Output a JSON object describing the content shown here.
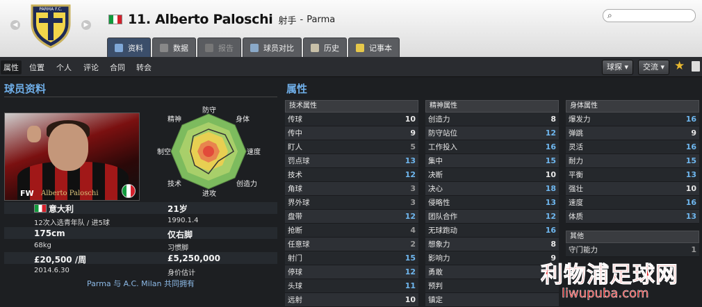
{
  "header": {
    "player_number_name": "11. Alberto Paloschi",
    "role": "射手",
    "club": "Parma",
    "crest_text": "PARMA F.C.",
    "search_icon": "search-icon"
  },
  "tabs": [
    {
      "label": "资料",
      "icon": "profile-icon"
    },
    {
      "label": "数据",
      "icon": "stats-icon"
    },
    {
      "label": "报告",
      "icon": "report-icon"
    },
    {
      "label": "球员对比",
      "icon": "compare-icon"
    },
    {
      "label": "历史",
      "icon": "history-icon"
    },
    {
      "label": "记事本",
      "icon": "notebook-icon"
    }
  ],
  "subnav": {
    "items": [
      "属性",
      "位置",
      "个人",
      "评论",
      "合同",
      "转会"
    ],
    "scout_button": "球探",
    "interact_button": "交流"
  },
  "profile": {
    "title": "球员资料",
    "position": "FW",
    "photo_caption": "Alberto Paloschi",
    "radar_labels": [
      "防守",
      "身体",
      "速度",
      "创造力",
      "进攻",
      "技术",
      "制空",
      "精神"
    ],
    "nationality": "意大利",
    "caps": "12次入选青年队 / 进5球",
    "age": "21岁",
    "dob": "1990.1.4",
    "height": "175cm",
    "weight": "68kg",
    "foot": "仅右脚",
    "foot_label": "习惯脚",
    "wage": "£20,500 /周",
    "contract_end": "2014.6.30",
    "value": "£5,250,000",
    "value_label": "身价估计",
    "ownership": "Parma 与 A.C. Milan 共同拥有"
  },
  "attributes": {
    "title": "属性",
    "technical": {
      "header": "技术属性",
      "rows": [
        {
          "name": "传球",
          "value": "10"
        },
        {
          "name": "传中",
          "value": "9"
        },
        {
          "name": "盯人",
          "value": "5"
        },
        {
          "name": "罚点球",
          "value": "13"
        },
        {
          "name": "技术",
          "value": "12"
        },
        {
          "name": "角球",
          "value": "3"
        },
        {
          "name": "界外球",
          "value": "3"
        },
        {
          "name": "盘带",
          "value": "12"
        },
        {
          "name": "抢断",
          "value": "4"
        },
        {
          "name": "任意球",
          "value": "2"
        },
        {
          "name": "射门",
          "value": "15"
        },
        {
          "name": "停球",
          "value": "12"
        },
        {
          "name": "头球",
          "value": "11"
        },
        {
          "name": "远射",
          "value": "10"
        }
      ]
    },
    "mental": {
      "header": "精神属性",
      "rows": [
        {
          "name": "创造力",
          "value": "8"
        },
        {
          "name": "防守站位",
          "value": "12"
        },
        {
          "name": "工作投入",
          "value": "16"
        },
        {
          "name": "集中",
          "value": "15"
        },
        {
          "name": "决断",
          "value": "10"
        },
        {
          "name": "决心",
          "value": "18"
        },
        {
          "name": "侵略性",
          "value": "13"
        },
        {
          "name": "团队合作",
          "value": "12"
        },
        {
          "name": "无球跑动",
          "value": "16"
        },
        {
          "name": "想象力",
          "value": "8"
        },
        {
          "name": "影响力",
          "value": "9"
        },
        {
          "name": "勇敢",
          "value": ""
        },
        {
          "name": "预判",
          "value": ""
        },
        {
          "name": "镇定",
          "value": ""
        }
      ]
    },
    "physical": {
      "header": "身体属性",
      "rows": [
        {
          "name": "爆发力",
          "value": "16"
        },
        {
          "name": "弹跳",
          "value": "9"
        },
        {
          "name": "灵活",
          "value": "16"
        },
        {
          "name": "耐力",
          "value": "15"
        },
        {
          "name": "平衡",
          "value": "13"
        },
        {
          "name": "强壮",
          "value": "10"
        },
        {
          "name": "速度",
          "value": "16"
        },
        {
          "name": "体质",
          "value": "13"
        }
      ]
    },
    "other": {
      "header": "其他",
      "rows": [
        {
          "name": "守门能力",
          "value": "1"
        }
      ]
    }
  },
  "watermark": {
    "text": "利物浦足球网",
    "url": "liwupuba.com"
  },
  "colors": {
    "accent_blue": "#6faee8",
    "value_high": "#6fb7ef",
    "value_mid": "#e8e8e8",
    "value_low": "#9a9a9a"
  }
}
